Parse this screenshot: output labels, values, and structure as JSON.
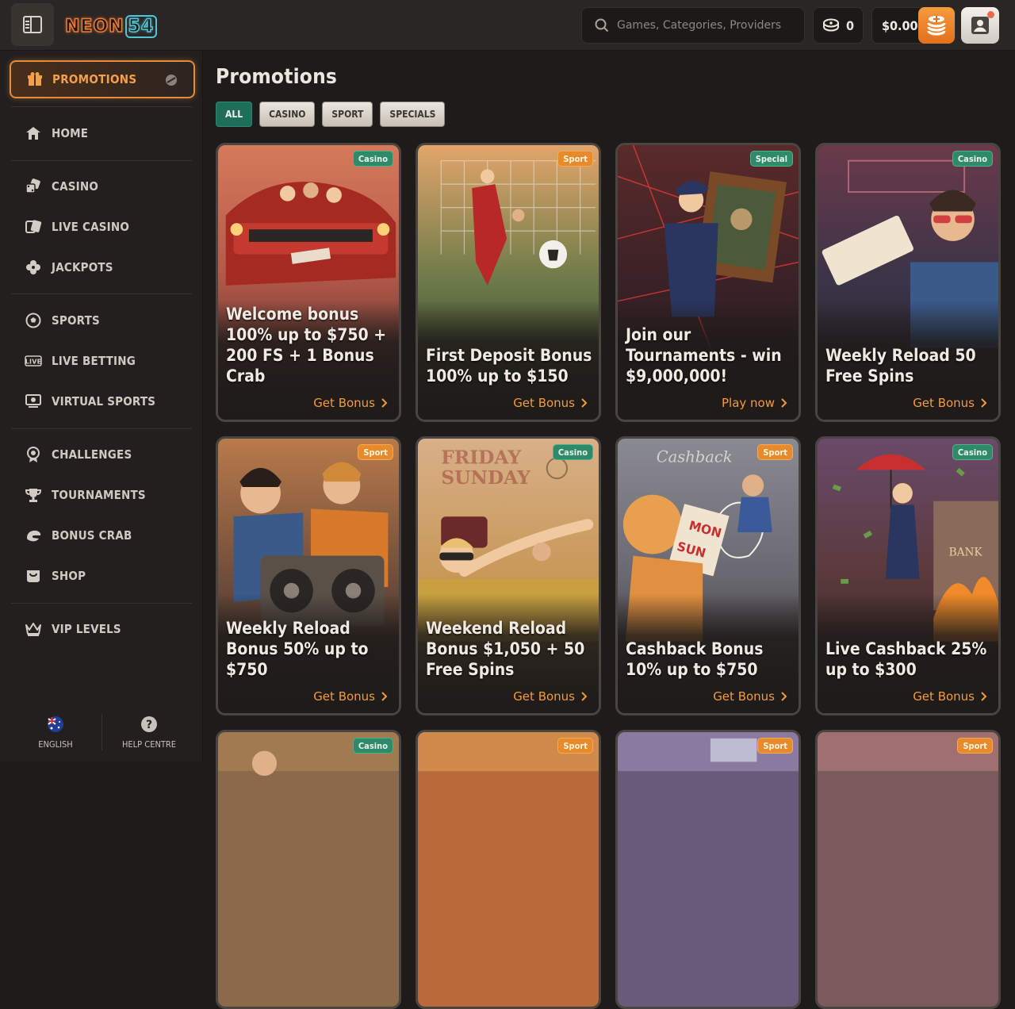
{
  "header": {
    "logo_text_a": "NEON",
    "logo_text_b": "54",
    "search_placeholder": "Games, Categories, Providers",
    "coins_count": "0",
    "balance": "$0.00"
  },
  "sidebar": {
    "active_item": "PROMOTIONS",
    "items": [
      {
        "label": "HOME",
        "icon": "home-icon"
      },
      {
        "label": "CASINO",
        "icon": "dice-icon"
      },
      {
        "label": "LIVE CASINO",
        "icon": "live-cards-icon"
      },
      {
        "label": "JACKPOTS",
        "icon": "clover-icon"
      },
      {
        "label": "SPORTS",
        "icon": "soccer-ball-icon"
      },
      {
        "label": "LIVE BETTING",
        "icon": "live-badge-icon"
      },
      {
        "label": "VIRTUAL SPORTS",
        "icon": "monitor-icon"
      },
      {
        "label": "CHALLENGES",
        "icon": "medal-icon"
      },
      {
        "label": "TOURNAMENTS",
        "icon": "trophy-icon"
      },
      {
        "label": "BONUS CRAB",
        "icon": "crab-icon"
      },
      {
        "label": "SHOP",
        "icon": "shop-icon"
      },
      {
        "label": "VIP LEVELS",
        "icon": "crown-icon"
      }
    ],
    "language": "ENGLISH",
    "help": "HELP CENTRE"
  },
  "main": {
    "title": "Promotions",
    "filters": [
      "ALL",
      "CASINO",
      "SPORT",
      "SPECIALS"
    ],
    "active_filter": "ALL",
    "cards": [
      {
        "tag": "Casino",
        "title": "Welcome bonus 100% up to $750 + 200 FS + 1 Bonus Crab",
        "cta": "Get Bonus"
      },
      {
        "tag": "Sport",
        "title": "First Deposit Bonus 100% up to $150",
        "cta": "Get Bonus"
      },
      {
        "tag": "Special",
        "title": "Join our Tournaments - win $9,000,000!",
        "cta": "Play now"
      },
      {
        "tag": "Casino",
        "title": "Weekly Reload 50 Free Spins",
        "cta": "Get Bonus"
      },
      {
        "tag": "Sport",
        "title": "Weekly Reload Bonus 50% up to $750",
        "cta": "Get Bonus"
      },
      {
        "tag": "Casino",
        "title": "Weekend Reload Bonus $1,050 + 50 Free Spins",
        "cta": "Get Bonus"
      },
      {
        "tag": "Sport",
        "title": "Cashback Bonus 10% up to $750",
        "cta": "Get Bonus"
      },
      {
        "tag": "Casino",
        "title": "Live Cashback 25% up to $300",
        "cta": "Get Bonus"
      },
      {
        "tag": "Casino",
        "title": "",
        "cta": ""
      },
      {
        "tag": "Sport",
        "title": "",
        "cta": ""
      },
      {
        "tag": "Sport",
        "title": "",
        "cta": ""
      },
      {
        "tag": "Sport",
        "title": "",
        "cta": ""
      }
    ]
  },
  "colors": {
    "accent_orange": "#f39b3d",
    "casino_tag": "#2f8a6a",
    "sport_tag": "#e78a2c",
    "active_filter": "#1f6e5a"
  }
}
